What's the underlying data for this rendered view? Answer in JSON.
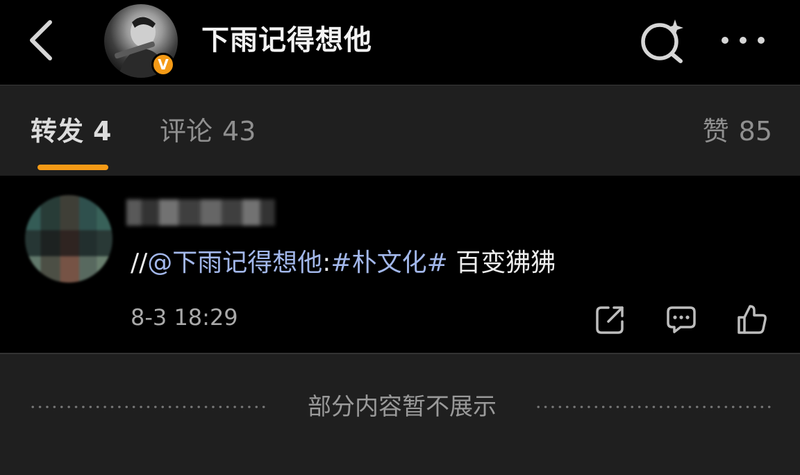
{
  "header": {
    "title": "下雨记得想他",
    "verified_badge": "V"
  },
  "tabs": {
    "repost": {
      "label": "转发",
      "count": "4"
    },
    "comment": {
      "label": "评论",
      "count": "43"
    },
    "like": {
      "label": "赞",
      "count": "85"
    }
  },
  "repost_item": {
    "text_prefix": "//",
    "mention": "@下雨记得想他",
    "separator": ":",
    "hashtag": "#朴文化#",
    "body": " 百变狒狒",
    "time": "8-3 18:29"
  },
  "footer": {
    "notice": "部分内容暂不展示"
  },
  "colors": {
    "accent": "#f49a16",
    "link": "#a2b7ea",
    "background": "#1f1f1f",
    "header_bg": "#000000"
  },
  "icons": [
    "back-arrow-icon",
    "search-sparkle-icon",
    "more-dots-icon",
    "share-icon",
    "comment-icon",
    "like-icon"
  ]
}
